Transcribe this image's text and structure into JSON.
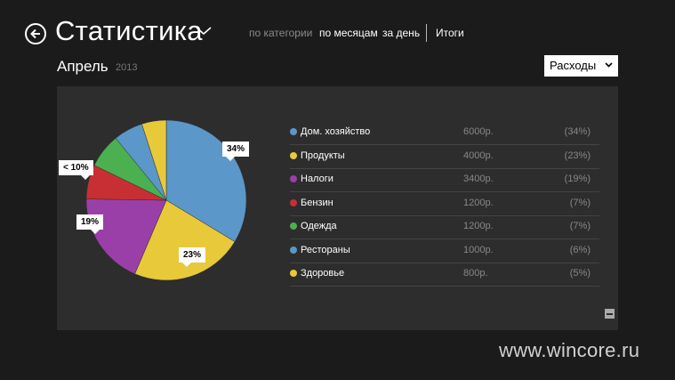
{
  "header": {
    "title": "Статистика",
    "nav": [
      {
        "label": "по категории",
        "active": false
      },
      {
        "label": "по месяцам",
        "active": true
      },
      {
        "label": "за день",
        "active": true
      },
      {
        "label": "Итоги",
        "active": true
      }
    ]
  },
  "period": {
    "month": "Апрель",
    "year": "2013"
  },
  "filter": {
    "selected": "Расходы"
  },
  "chart_data": {
    "type": "pie",
    "categories": [
      "Дом. хозяйство",
      "Продукты",
      "Налоги",
      "Бензин",
      "Одежда",
      "Рестораны",
      "Здоровье"
    ],
    "amounts": [
      "6000р.",
      "4000р.",
      "3400р.",
      "1200р.",
      "1200р.",
      "1000р.",
      "800р."
    ],
    "percents": [
      "(34%)",
      "(23%)",
      "(19%)",
      "(7%)",
      "(7%)",
      "(6%)",
      "(5%)"
    ],
    "values": [
      34,
      23,
      19,
      7,
      7,
      6,
      5
    ],
    "colors": [
      "#5b97c9",
      "#e7c93a",
      "#9a3fa7",
      "#c72f35",
      "#4caf50",
      "#5b97c9",
      "#e7c93a"
    ],
    "labels": {
      "dom": "34%",
      "prod": "23%",
      "nalogi": "19%",
      "benzin": "< 10%"
    }
  },
  "watermark": "www.wincore.ru"
}
